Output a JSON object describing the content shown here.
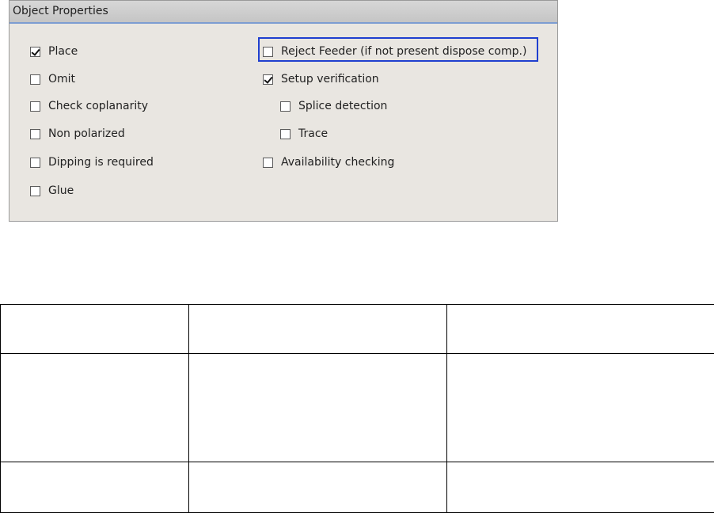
{
  "panel": {
    "title": "Object Properties",
    "left_options": [
      {
        "label": "Place",
        "checked": true
      },
      {
        "label": "Omit",
        "checked": false
      },
      {
        "label": "Check coplanarity",
        "checked": false
      },
      {
        "label": "Non polarized",
        "checked": false
      },
      {
        "label": "Dipping is required",
        "checked": false
      },
      {
        "label": "Glue",
        "checked": false
      }
    ],
    "right_options": [
      {
        "label": "Reject Feeder (if not present dispose comp.)",
        "checked": false
      },
      {
        "label": "Setup verification",
        "checked": true
      },
      {
        "label": "Splice detection",
        "checked": false
      },
      {
        "label": "Trace",
        "checked": false
      },
      {
        "label": "Availability checking",
        "checked": false
      }
    ]
  },
  "colors": {
    "highlight_border": "#1f3fcf",
    "header_underline": "#7d9dd2",
    "panel_background": "#e9e6e1"
  }
}
